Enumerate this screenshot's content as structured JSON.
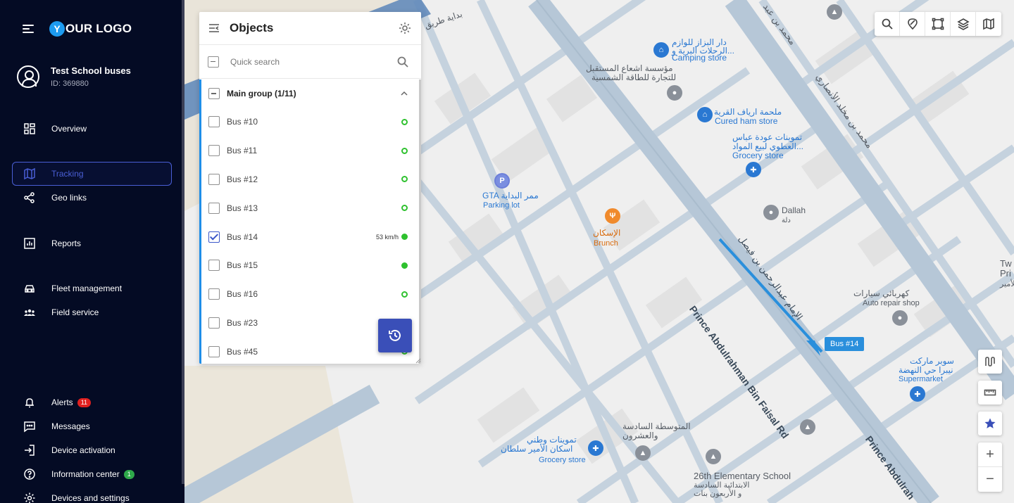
{
  "sidebar": {
    "logo_letter": "Y",
    "logo_text": "OUR LOGO",
    "account_name": "Test School buses",
    "account_id": "ID: 369880",
    "nav": {
      "overview": "Overview",
      "tracking": "Tracking",
      "geo_links": "Geo links",
      "reports": "Reports",
      "fleet": "Fleet management",
      "field": "Field service",
      "alerts": "Alerts",
      "alerts_count": "11",
      "messages": "Messages",
      "device_activation": "Device activation",
      "info_center": "Information center",
      "info_count": "1",
      "devices_settings": "Devices and settings"
    },
    "colors": {
      "background": "#040b24",
      "active": "#4a5fd6",
      "alert_badge": "#e0201f",
      "info_badge": "#2ea84a"
    }
  },
  "panel": {
    "title": "Objects",
    "search_placeholder": "Quick search",
    "group_label": "Main group (1/11)",
    "objects": [
      {
        "name": "Bus #10",
        "checked": false,
        "status": "ring",
        "speed": ""
      },
      {
        "name": "Bus #11",
        "checked": false,
        "status": "ring",
        "speed": ""
      },
      {
        "name": "Bus #12",
        "checked": false,
        "status": "ring",
        "speed": ""
      },
      {
        "name": "Bus #13",
        "checked": false,
        "status": "ring",
        "speed": ""
      },
      {
        "name": "Bus #14",
        "checked": true,
        "status": "solid",
        "speed": "53 km/h"
      },
      {
        "name": "Bus #15",
        "checked": false,
        "status": "solid",
        "speed": ""
      },
      {
        "name": "Bus #16",
        "checked": false,
        "status": "ring",
        "speed": ""
      },
      {
        "name": "Bus #23",
        "checked": false,
        "status": "ring",
        "speed": ""
      },
      {
        "name": "Bus #45",
        "checked": false,
        "status": "ring",
        "speed": ""
      }
    ]
  },
  "map": {
    "bus_marker": "Bus #14",
    "labels": {
      "top_road_ar": "بداية طريق",
      "camping_ar1": "دار البزاز للوازم",
      "camping_ar2": "الرحلات البرية و...",
      "camping_en": "Camping store",
      "solar_ar1": "مؤسسة اشعاع المستقبل",
      "solar_ar2": "للتجارة للطاقة الشمسية",
      "ham_ar": "ملحمة ارياف القرية",
      "ham_en": "Cured ham store",
      "grocery1_ar1": "تموينات عودة عباس",
      "grocery1_ar2": "العطوي لبيع المواد...",
      "grocery1_en": "Grocery store",
      "gta_ar": "GTA ممر البداية",
      "parking_en": "Parking lot",
      "brunch_ar": "الإسكان",
      "brunch_en": "Brunch",
      "dallah_en": "Dallah",
      "dallah_ar": "دلة",
      "auto_ar": "كهربائي سيارات",
      "auto_en": "Auto repair shop",
      "super_ar1": "سوبر ماركت",
      "super_ar2": "نيبرا حي النهضة",
      "super_en": "Supermarket",
      "middle_ar1": "المتوسطة السادسة",
      "middle_ar2": "والعشرون",
      "grocery2_ar1": "تموينات وطني",
      "grocery2_ar2": "اسكان الأمير سلطان",
      "grocery2_en": "Grocery store",
      "school_en": "26th Elementary School",
      "school_ar1": "الابتدائية السادسة",
      "school_ar2": "و الأربعون بنات",
      "road_main_en": "Prince Abdulrahman Bin Faisal Rd",
      "road_main_ar": "الإمام عبدالرحمن بن فيصل",
      "road_right_en": "Prince Abdulrah",
      "road_top_right_ar": "محمد بن مخلد الأنصاري",
      "road_top_ar2": "محمد بن عبد",
      "edge_label_1": "Tw",
      "edge_label_2": "Pri",
      "edge_label_3": "الأمير"
    }
  }
}
